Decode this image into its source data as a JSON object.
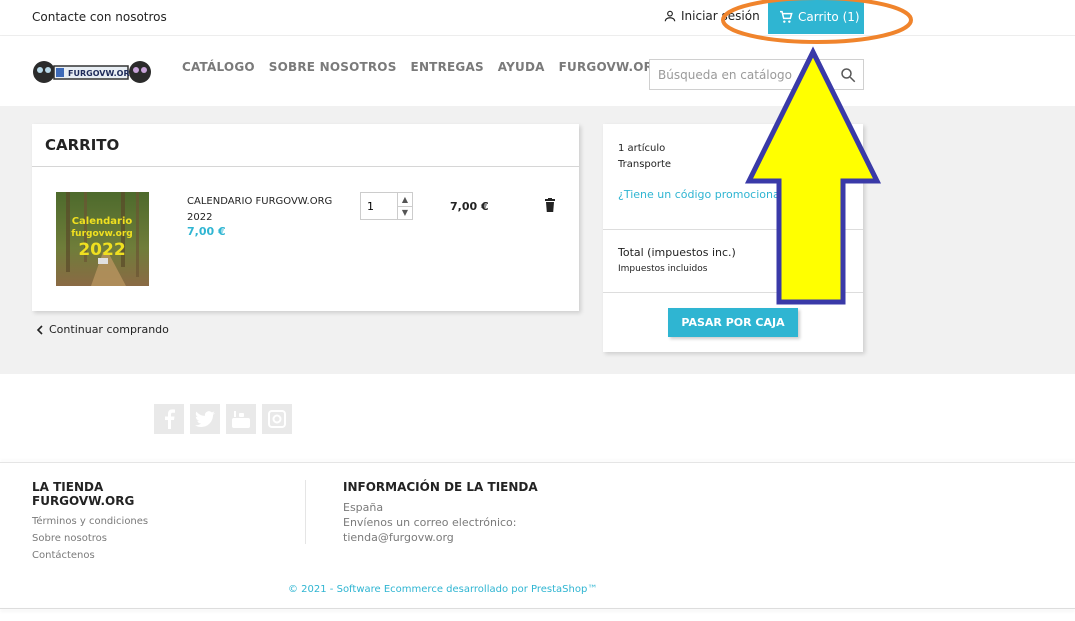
{
  "topbar": {
    "contact": "Contacte con nosotros",
    "login": "Iniciar sesión",
    "cart": "Carrito (1)"
  },
  "header": {
    "logo_text": "FURGOVW.ORG",
    "nav": [
      "CATÁLOGO",
      "SOBRE NOSOTROS",
      "ENTREGAS",
      "AYUDA",
      "FURGOVW.ORG"
    ],
    "search_placeholder": "Búsqueda en catálogo"
  },
  "cart": {
    "title": "CARRITO",
    "product": {
      "name": "CALENDARIO FURGOVW.ORG 2022",
      "price": "7,00 €",
      "quantity": "1",
      "line_total": "7,00 €",
      "image_text_1": "Calendario",
      "image_text_2": "furgovw.org",
      "image_text_3": "2022"
    },
    "continue": "Continuar comprando"
  },
  "summary": {
    "items": "1 artículo",
    "shipping": "Transporte",
    "promo": "¿Tiene un código promocional?",
    "total_label": "Total (impuestos inc.)",
    "tax_label": "Impuestos incluidos",
    "checkout": "PASAR POR CAJA"
  },
  "footer": {
    "store_title": "LA TIENDA FURGOVW.ORG",
    "links": [
      "Términos y condiciones",
      "Sobre nosotros",
      "Contáctenos"
    ],
    "info_title": "INFORMACIÓN DE LA TIENDA",
    "country": "España",
    "email_label": "Envíenos un correo electrónico:",
    "email": "tienda@furgovw.org",
    "copyright": "© 2021 - Software Ecommerce desarrollado por PrestaShop™"
  },
  "colors": {
    "accent": "#2fb5d2",
    "annotation_circle": "#f0842c",
    "annotation_arrow_fill": "#ffff00",
    "annotation_arrow_stroke": "#3a3aa8"
  }
}
